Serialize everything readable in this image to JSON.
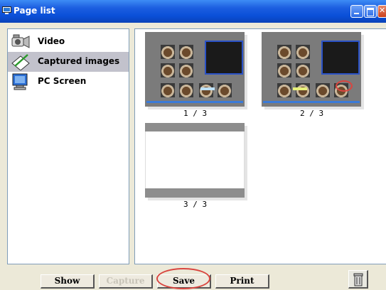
{
  "window": {
    "title": "Page list"
  },
  "sidebar": {
    "items": [
      {
        "label": "Video",
        "icon": "video-camera-icon",
        "selected": false
      },
      {
        "label": "Captured images",
        "icon": "captured-images-icon",
        "selected": true
      },
      {
        "label": "PC Screen",
        "icon": "pc-screen-icon",
        "selected": false
      }
    ]
  },
  "pages": [
    {
      "label": "1 / 3",
      "content": "captured-screen"
    },
    {
      "label": "2 / 3",
      "content": "captured-screen"
    },
    {
      "label": "3 / 3",
      "content": "blank"
    }
  ],
  "toolbar": {
    "show_label": "Show",
    "capture_label": "Capture",
    "save_label": "Save",
    "print_label": "Print",
    "trash_icon": "trash-icon",
    "capture_enabled": false,
    "highlighted": "Save",
    "highlight_color": "#d9453f"
  },
  "colors": {
    "titlebar": "#0a4fd8",
    "selection": "#c2c2cc"
  }
}
